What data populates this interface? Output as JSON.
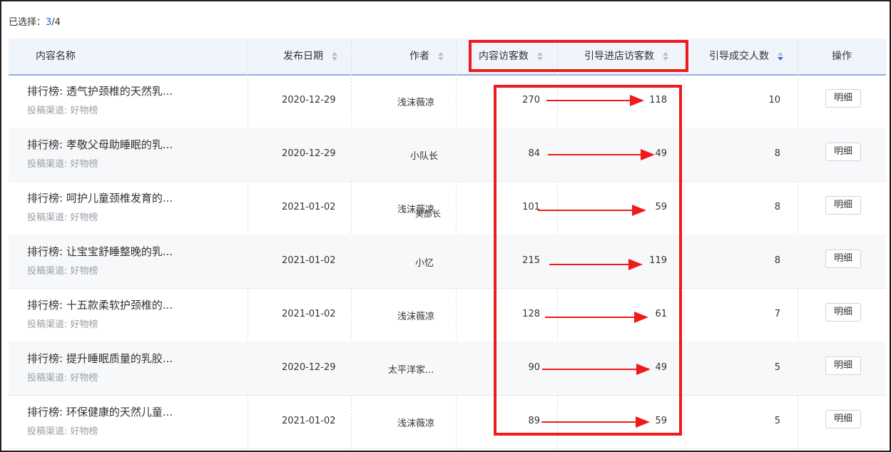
{
  "selection": {
    "label": "已选择：",
    "count": "3",
    "total": "/4"
  },
  "columns": {
    "content_name": "内容名称",
    "publish_date": "发布日期",
    "author": "作者",
    "content_visitors": "内容访客数",
    "guided_visitors": "引导进店访客数",
    "guided_deals": "引导成交人数",
    "actions": "操作"
  },
  "rows": [
    {
      "title": "排行榜: 透气护颈椎的天然乳...",
      "channel": "投稿渠道: 好物榜",
      "date": "2020-12-29",
      "author": "浅沫薇凉",
      "content_visitors": "270",
      "guided_visitors": "118",
      "guided_deals": "10",
      "action": "明细"
    },
    {
      "title": "排行榜: 孝敬父母助睡眠的乳...",
      "channel": "投稿渠道: 好物榜",
      "date": "2020-12-29",
      "author": "小队长",
      "content_visitors": "84",
      "guided_visitors": "49",
      "guided_deals": "8",
      "action": "明细"
    },
    {
      "title": "排行榜: 呵护儿童颈椎发育的...",
      "channel": "投稿渠道: 好物榜",
      "date": "2021-01-02",
      "author": "浅沫薇凉",
      "author2": "美部长",
      "content_visitors": "101",
      "guided_visitors": "59",
      "guided_deals": "8",
      "action": "明细"
    },
    {
      "title": "排行榜: 让宝宝舒睡整晚的乳...",
      "channel": "投稿渠道: 好物榜",
      "date": "2021-01-02",
      "author": "小忆",
      "content_visitors": "215",
      "guided_visitors": "119",
      "guided_deals": "8",
      "action": "明细"
    },
    {
      "title": "排行榜: 十五款柔软护颈椎的...",
      "channel": "投稿渠道: 好物榜",
      "date": "2021-01-02",
      "author": "浅沫薇凉",
      "content_visitors": "128",
      "guided_visitors": "61",
      "guided_deals": "7",
      "action": "明细"
    },
    {
      "title": "排行榜: 提升睡眠质量的乳胶...",
      "channel": "投稿渠道: 好物榜",
      "date": "2020-12-29",
      "author": "太平洋家...",
      "content_visitors": "90",
      "guided_visitors": "49",
      "guided_deals": "5",
      "action": "明细"
    },
    {
      "title": "排行榜: 环保健康的天然儿童...",
      "channel": "投稿渠道: 好物榜",
      "date": "2021-01-02",
      "author": "浅沫薇凉",
      "content_visitors": "89",
      "guided_visitors": "59",
      "guided_deals": "5",
      "action": "明细"
    }
  ],
  "colors": {
    "accent": "#2f6fe0",
    "annotation": "#ee1b1b",
    "header_bg": "#f0f4fb"
  },
  "icons": {
    "sort": "sort-caret-icon",
    "arrow": "red-arrow-annotation"
  }
}
